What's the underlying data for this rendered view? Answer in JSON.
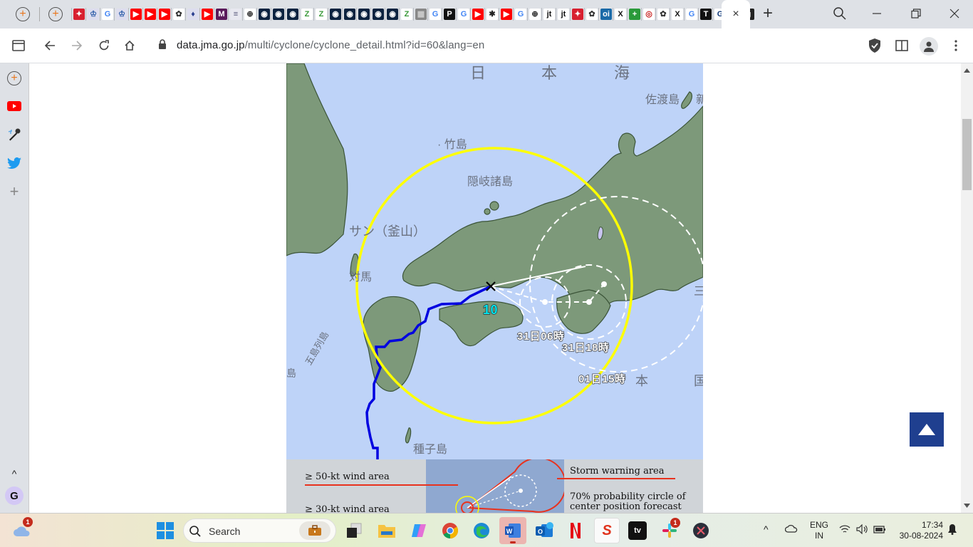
{
  "browser": {
    "tabs_favicons": [
      "china-daily",
      "columbia",
      "google",
      "columbia",
      "youtube",
      "youtube",
      "youtube",
      "chatgpt",
      "shield",
      "youtube",
      "m-logo",
      "doc",
      "globe",
      "ox",
      "ox",
      "ox",
      "z",
      "z",
      "ox",
      "ox",
      "ox",
      "ox",
      "ox",
      "z",
      "gray",
      "google",
      "p",
      "google",
      "youtube",
      "pattern",
      "youtube",
      "google",
      "globe",
      "jt",
      "jt",
      "china-daily",
      "chatgpt",
      "oi",
      "x",
      "plus",
      "swirl",
      "chatgpt",
      "x",
      "google",
      "t",
      "g-blue",
      "drop",
      "g-box"
    ],
    "active_tab_close": "×",
    "new_tab": "+",
    "url_domain": "data.jma.go.jp",
    "url_path": "/multi/cyclone/cyclone_detail.html?id=60&lang=en"
  },
  "sidebar": {
    "items": [
      {
        "name": "add-tab"
      },
      {
        "name": "youtube"
      },
      {
        "name": "karaoke"
      },
      {
        "name": "twitter"
      },
      {
        "name": "add"
      }
    ],
    "collapse": "^",
    "profile_initial": "G"
  },
  "map": {
    "labels": {
      "sea_1": "日",
      "sea_2": "本",
      "sea_3": "海",
      "sado": "佐渡島",
      "niigata": "新",
      "takeshima": "竹島",
      "oki": "隠岐諸島",
      "busan": "サン（釜山）",
      "tsushima": "対馬",
      "goto": "五島列島",
      "shima": "島",
      "tanegashima": "種子島",
      "mie": "三",
      "pacific_hon": "本",
      "pacific_koku": "国"
    },
    "typhoon_number": "10",
    "forecast_times": [
      "31日06時",
      "31日18時",
      "01日15時"
    ],
    "colors": {
      "sea": "#bed3f8",
      "land": "#7d997a",
      "track": "#0000e0",
      "wind30": "#ffff00",
      "forecast": "#ffffff",
      "typhoon_number": "#00e5ee"
    }
  },
  "legend": {
    "wind50": "≥ 50-kt wind area",
    "wind30": "≥ 30-kt wind area",
    "storm_warning": "Storm warning area",
    "prob_circle_1": "70% probability circle of",
    "prob_circle_2": "center position forecast"
  },
  "taskbar": {
    "weather_badge": "1",
    "search_placeholder": "Search",
    "slack_badge": "1",
    "lang_1": "ENG",
    "lang_2": "IN",
    "time": "17:34",
    "date": "30-08-2024"
  }
}
